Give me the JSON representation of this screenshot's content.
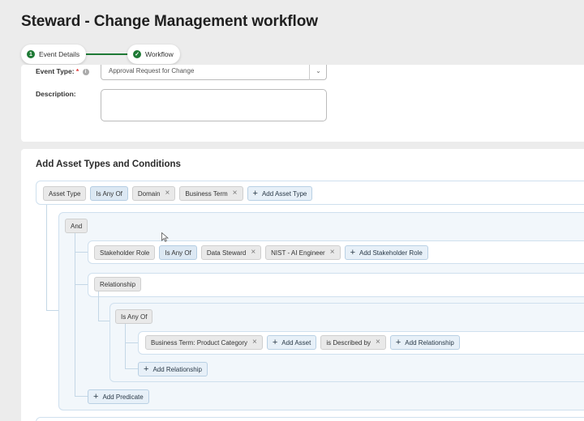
{
  "page": {
    "title": "Steward - Change Management workflow"
  },
  "stepper": {
    "steps": [
      {
        "label": "Event Details",
        "marker": "1"
      },
      {
        "label": "Workflow",
        "marker": "✓"
      }
    ]
  },
  "form": {
    "event_type_label": "Event Type:",
    "required_mark": "*",
    "event_type_value": "Approval Request for Change",
    "description_label": "Description:",
    "description_value": ""
  },
  "conditions": {
    "title": "Add Asset Types and Conditions",
    "asset_row": {
      "field": "Asset Type",
      "operator": "Is Any Of",
      "values": [
        "Domain",
        "Business Term"
      ],
      "add": "Add Asset Type"
    },
    "and_label": "And",
    "stakeholder_row": {
      "field": "Stakeholder Role",
      "operator": "Is Any Of",
      "values": [
        "Data Steward",
        "NIST - AI Engineer"
      ],
      "add": "Add Stakeholder Role"
    },
    "relationship_label": "Relationship",
    "is_any_of_label": "Is Any Of",
    "relation_row": {
      "asset": "Business Term: Product Category",
      "add_asset": "Add Asset",
      "relation": "is Described by",
      "add_relationship": "Add Relationship"
    },
    "add_relationship_inner": "Add Relationship",
    "add_predicate": "Add Predicate"
  },
  "colors": {
    "accent_green": "#1e7a35",
    "chip_blue": "#dce8f3",
    "connector": "#c4d7e6"
  }
}
